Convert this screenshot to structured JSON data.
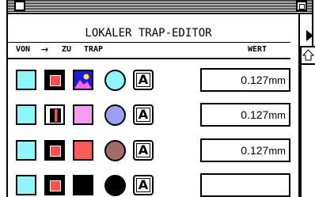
{
  "window": {
    "title": "LOKALER TRAP-EDITOR"
  },
  "columns": {
    "von": "VON",
    "arrow": "→",
    "zu": "ZU",
    "trap": "TRAP",
    "wert": "WERT"
  },
  "rows": [
    {
      "zu_kind": "image",
      "zu_color": "#1b1bd8",
      "trap_color": "#8ff6fb",
      "text_tool_glyph": "A",
      "value": "0.127",
      "unit": "mm"
    },
    {
      "zu_kind": "solid",
      "zu_color": "#f59cf2",
      "trap_color": "#9da0f7",
      "text_tool_glyph": "A",
      "value": "0.127",
      "unit": "mm"
    },
    {
      "zu_kind": "solid",
      "zu_color": "#ff5b5b",
      "trap_color": "#a46a6a",
      "text_tool_glyph": "A",
      "value": "0.127",
      "unit": "mm"
    },
    {
      "zu_kind": "solid",
      "zu_color": "#000000",
      "trap_color": "#000000",
      "text_tool_glyph": "A",
      "value": "",
      "unit": ""
    }
  ],
  "icons": {
    "close": "close-box-icon",
    "zoom": "zoom-box-icon",
    "expand": "triangle-right-icon",
    "scroll_up": "scroll-up-arrow-icon"
  }
}
